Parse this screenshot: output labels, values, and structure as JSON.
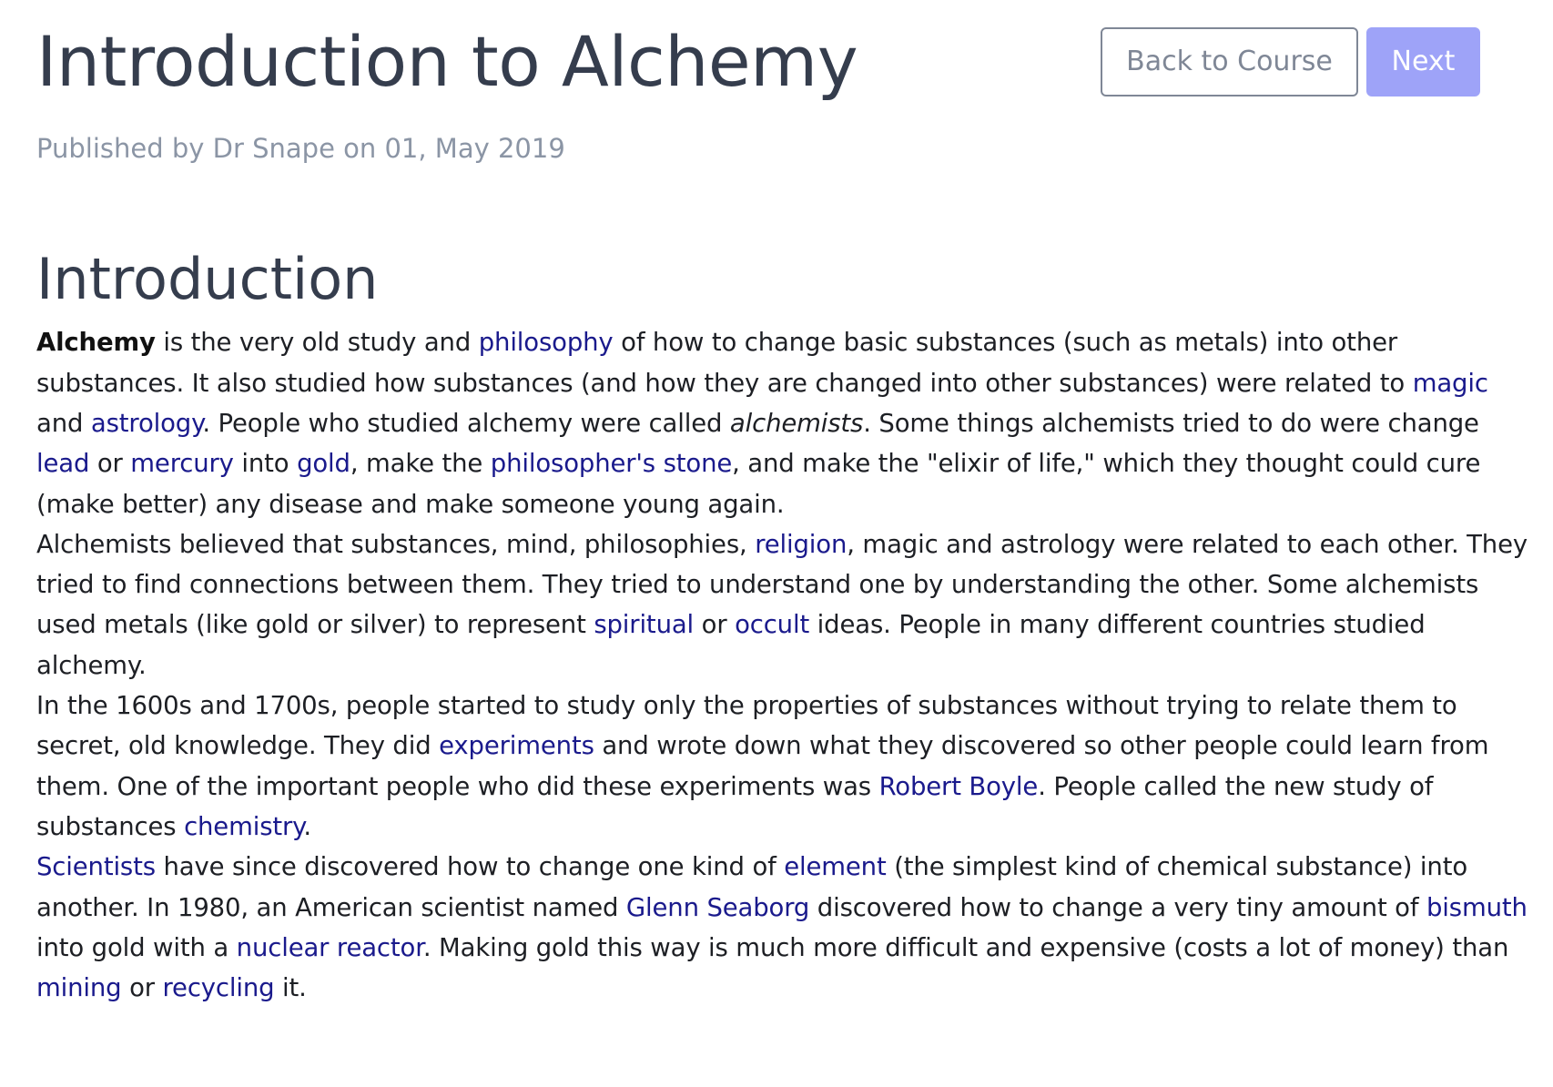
{
  "header": {
    "title": "Introduction to Alchemy",
    "byline": "Published by Dr Snape on 01, May 2019",
    "back_label": "Back to Course",
    "next_label": "Next"
  },
  "article": {
    "heading": "Introduction",
    "p1": {
      "t1": "Alchemy",
      "t2": " is the very old study and ",
      "link_philosophy": "philosophy",
      "t3": " of how to change basic substances (such as metals) into other substances. It also studied how substances (and how they are changed into other substances) were related to ",
      "link_magic": "magic",
      "t4": " and ",
      "link_astrology": "astrology",
      "t5": ". People who studied alchemy were called ",
      "t6": "alchemists",
      "t7": ". Some things alchemists tried to do were change ",
      "link_lead": "lead",
      "t8": " or ",
      "link_mercury": "mercury",
      "t9": " into ",
      "link_gold": "gold",
      "t10": ", make the ",
      "link_stone": "philosopher's stone",
      "t11": ", and make the \"elixir of life,\" which they thought could cure (make better) any disease and make someone young again."
    },
    "p2": {
      "t1": "Alchemists believed that substances, mind, philosophies, ",
      "link_religion": "religion",
      "t2": ", magic and astrology were related to each other. They tried to find connections between them. They tried to understand one by understanding the other. Some alchemists used metals (like gold or silver) to represent ",
      "link_spiritual": "spiritual",
      "t3": " or ",
      "link_occult": "occult",
      "t4": " ideas. People in many different countries studied alchemy."
    },
    "p3": {
      "t1": "In the 1600s and 1700s, people started to study only the properties of substances without trying to relate them to secret, old knowledge. They did ",
      "link_experiments": "experiments",
      "t2": " and wrote down what they discovered so other people could learn from them. One of the important people who did these experiments was ",
      "link_boyle": "Robert Boyle",
      "t3": ". People called the new study of substances ",
      "link_chemistry": "chemistry",
      "t4": "."
    },
    "p4": {
      "link_scientists": "Scientists",
      "t1": " have since discovered how to change one kind of ",
      "link_element": "element",
      "t2": " (the simplest kind of chemical substance) into another. In 1980, an American scientist named ",
      "link_seaborg": "Glenn Seaborg",
      "t3": " discovered how to change a very tiny amount of ",
      "link_bismuth": "bismuth",
      "t4": " into gold with a ",
      "link_reactor": "nuclear reactor",
      "t5": ". Making gold this way is much more difficult and expensive (costs a lot of money) than ",
      "link_mining": "mining",
      "t6": " or ",
      "link_recycling": "recycling",
      "t7": " it."
    }
  },
  "colors": {
    "title": "#353d4d",
    "byline": "#8b95a5",
    "link": "#1a1a8c",
    "primary_button": "#9ea3f8"
  }
}
